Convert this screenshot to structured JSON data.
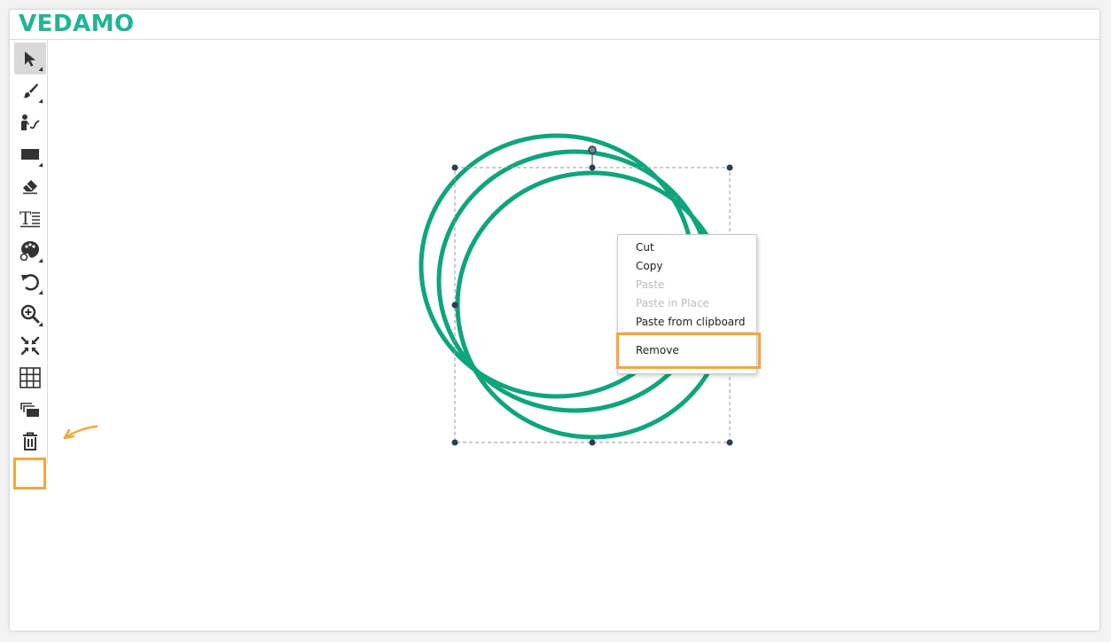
{
  "app": {
    "logo_text": "VEDAMO"
  },
  "toolbar": {
    "tools": [
      {
        "icon": "pointer-icon",
        "active": true
      },
      {
        "icon": "brush-icon"
      },
      {
        "icon": "presenter-icon"
      },
      {
        "icon": "rectangle-icon"
      },
      {
        "icon": "eraser-icon"
      },
      {
        "icon": "text-icon"
      },
      {
        "icon": "palette-icon"
      },
      {
        "icon": "undo-icon"
      },
      {
        "icon": "zoom-in-icon"
      },
      {
        "icon": "fit-icon"
      },
      {
        "icon": "grid-icon"
      },
      {
        "icon": "layers-icon"
      },
      {
        "icon": "trash-icon",
        "highlighted": true
      }
    ]
  },
  "context_menu": {
    "items": [
      {
        "label": "Cut",
        "enabled": true
      },
      {
        "label": "Copy",
        "enabled": true
      },
      {
        "label": "Paste",
        "enabled": false
      },
      {
        "label": "Paste in Place",
        "enabled": false
      },
      {
        "label": "Paste from clipboard",
        "enabled": true
      },
      {
        "label": "Remove",
        "enabled": true,
        "highlighted": true
      }
    ]
  },
  "colors": {
    "brand": "#1fb594",
    "shape_stroke": "#0fa57c",
    "highlight": "#f5a63c",
    "handle": "#2d3e50",
    "icon": "#333333"
  }
}
